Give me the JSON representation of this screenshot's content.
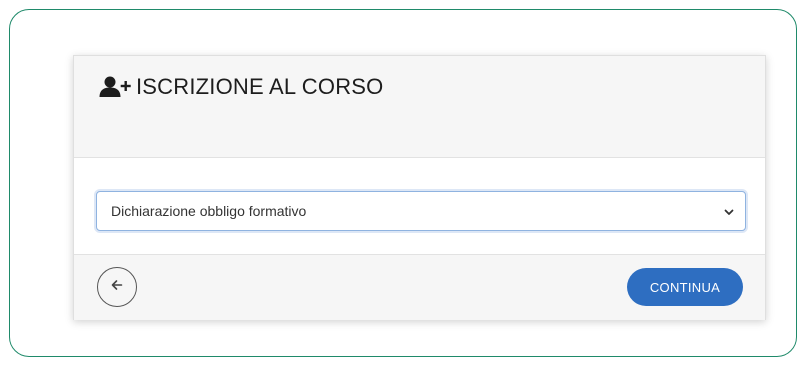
{
  "header": {
    "title": "ISCRIZIONE AL CORSO",
    "icon": "user-plus-icon"
  },
  "form": {
    "select_value": "Dichiarazione obbligo formativo",
    "chevron_icon": "chevron-down-icon"
  },
  "footer": {
    "back_icon": "arrow-left-icon",
    "continue_label": "CONTINUA"
  },
  "colors": {
    "frame_border": "#1f8a6a",
    "primary_button": "#2e6ec1",
    "panel_background": "#f6f6f6",
    "select_border": "#8fb3e0"
  }
}
